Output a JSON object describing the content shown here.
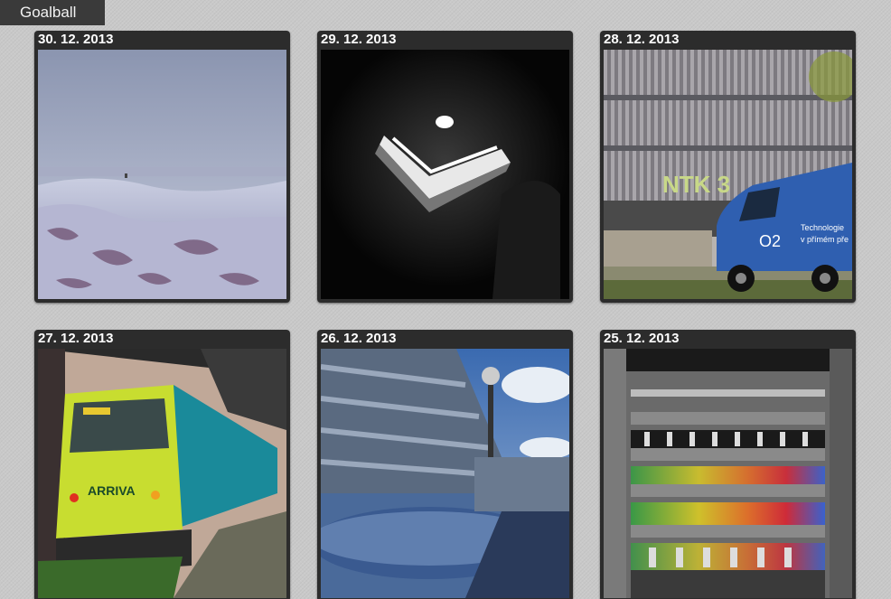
{
  "header": {
    "title": "Goalball"
  },
  "gallery": {
    "items": [
      {
        "date": "30. 12. 2013",
        "scene": "snowy-field"
      },
      {
        "date": "29. 12. 2013",
        "scene": "dark-light-fixture"
      },
      {
        "date": "28. 12. 2013",
        "scene": "building-with-van",
        "sign": "NTK 3",
        "van_brand": "O2",
        "van_text_1": "Technologie",
        "van_text_2": "v přímém pře"
      },
      {
        "date": "27. 12. 2013",
        "scene": "train",
        "train_brand": "ARRIVA"
      },
      {
        "date": "26. 12. 2013",
        "scene": "industrial-pipes"
      },
      {
        "date": "25. 12. 2013",
        "scene": "server-racks"
      }
    ]
  }
}
